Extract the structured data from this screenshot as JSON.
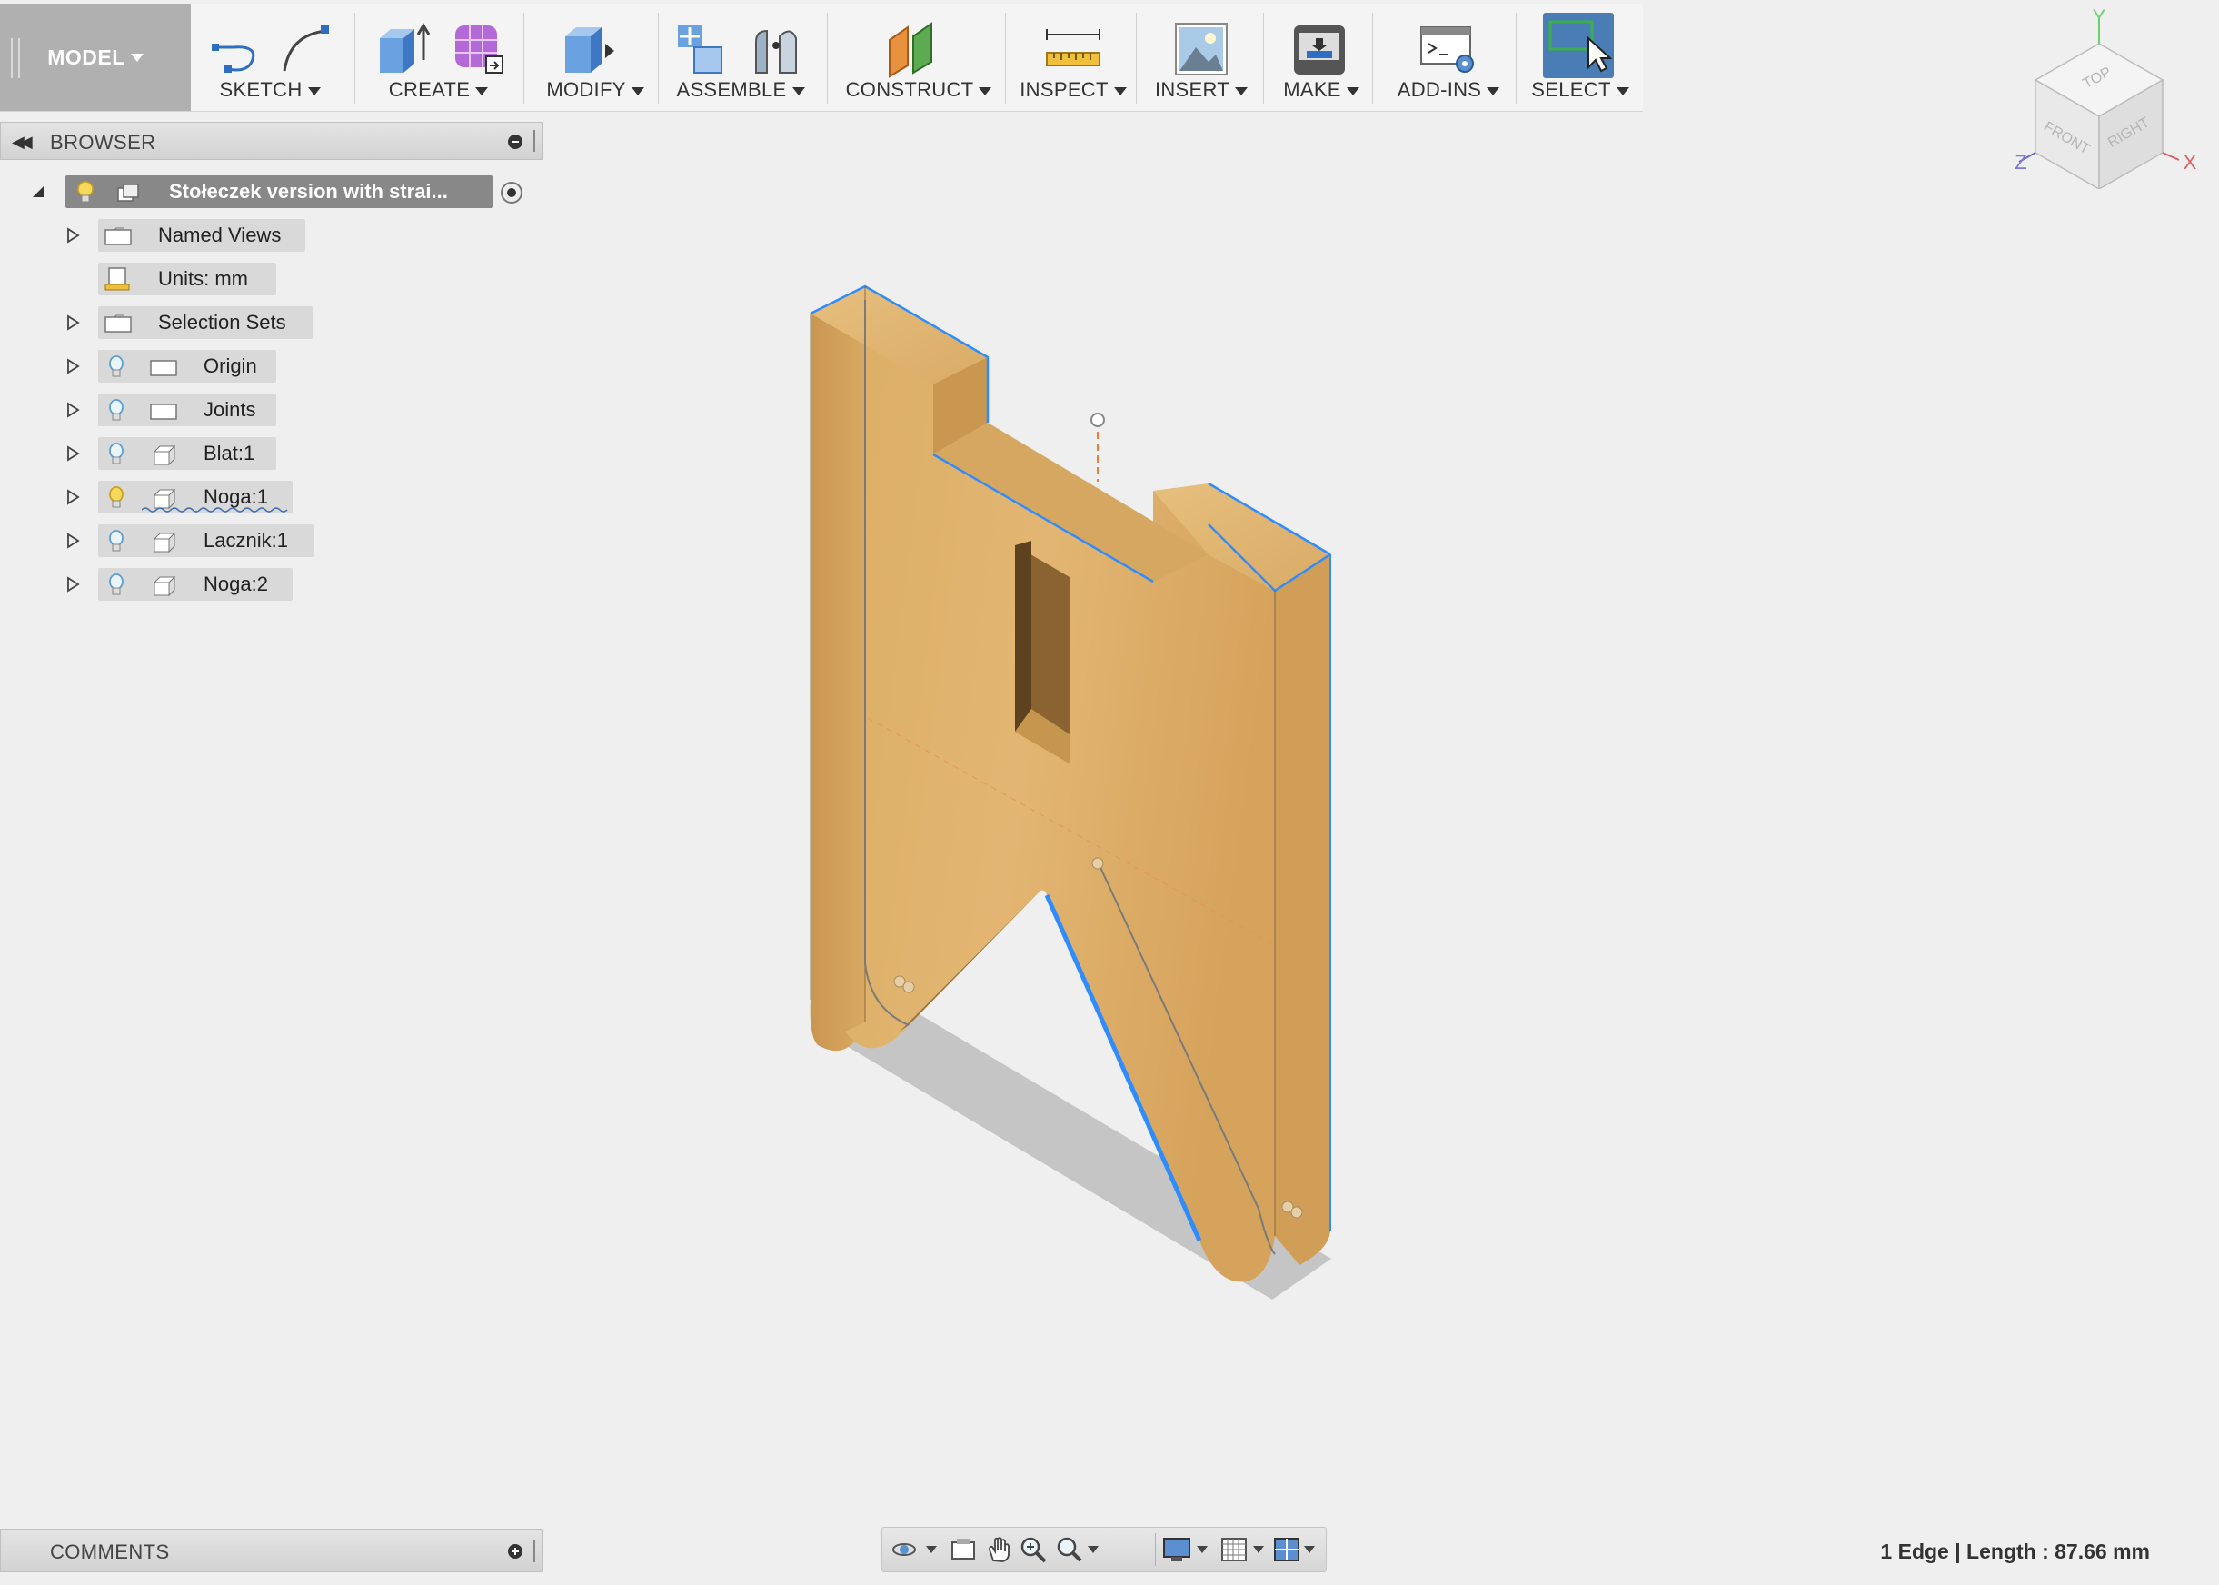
{
  "toolbar": {
    "model": "MODEL",
    "groups": [
      {
        "label": "SKETCH"
      },
      {
        "label": "CREATE"
      },
      {
        "label": "MODIFY"
      },
      {
        "label": "ASSEMBLE"
      },
      {
        "label": "CONSTRUCT"
      },
      {
        "label": "INSPECT"
      },
      {
        "label": "INSERT"
      },
      {
        "label": "MAKE"
      },
      {
        "label": "ADD-INS"
      },
      {
        "label": "SELECT"
      }
    ]
  },
  "browser": {
    "title": "BROWSER",
    "root": "Stołeczek version with strai...",
    "items": [
      {
        "label": "Named Views"
      },
      {
        "label": "Units: mm"
      },
      {
        "label": "Selection Sets"
      },
      {
        "label": "Origin"
      },
      {
        "label": "Joints"
      },
      {
        "label": "Blat:1"
      },
      {
        "label": "Noga:1"
      },
      {
        "label": "Lacznik:1"
      },
      {
        "label": "Noga:2"
      }
    ]
  },
  "viewcube": {
    "faces": {
      "top": "TOP",
      "front": "FRONT",
      "right": "RIGHT"
    },
    "axes": {
      "x": "X",
      "y": "Y",
      "z": "Z"
    }
  },
  "comments": {
    "title": "COMMENTS"
  },
  "status": "1 Edge | Length : 87.66 mm",
  "colors": {
    "wood": "#d9a75e",
    "selected_edge": "#2f8cff",
    "select_active": "#4a7db5"
  }
}
